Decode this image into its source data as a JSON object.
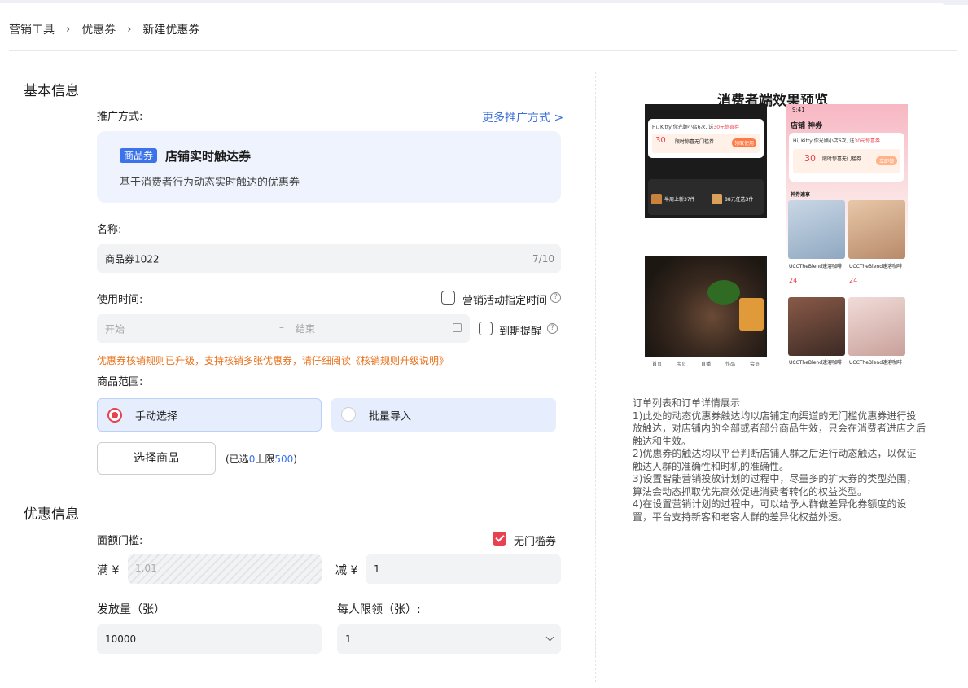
{
  "breadcrumb": [
    "营销工具",
    "优惠券",
    "新建优惠券"
  ],
  "sections": {
    "basic": "基本信息",
    "discount": "优惠信息"
  },
  "promo": {
    "label": "推广方式:",
    "more_link": "更多推广方式 >",
    "badge": "商品券",
    "title": "店铺实时触达券",
    "desc": "基于消费者行为动态实时触达的优惠券"
  },
  "name": {
    "label": "名称:",
    "value": "商品券1022",
    "counter": "7/10"
  },
  "time": {
    "label": "使用时间:",
    "campaign_check": "营销活动指定时间",
    "start_placeholder": "开始",
    "dash": "–",
    "end_placeholder": "结束",
    "remind_check": "到期提醒"
  },
  "warning": "优惠券核销规则已升级，支持核销多张优惠券，请仔细阅读《核销规则升级说明》",
  "scope": {
    "label": "商品范围:",
    "manual": "手动选择",
    "batch": "批量导入",
    "select_button": "选择商品",
    "selected_prefix": "(已选",
    "selected_count": "0",
    "limit_prefix": "上限",
    "limit_value": "500",
    "selected_suffix": ")"
  },
  "threshold": {
    "label": "面额门槛:",
    "no_threshold": "无门槛券",
    "full_label": "满 ¥",
    "full_value": "1.01",
    "minus_label": "减 ¥",
    "minus_value": "1"
  },
  "quantity": {
    "label": "发放量（张）",
    "value": "10000"
  },
  "per_user": {
    "label": "每人限领（张）:",
    "value": "1"
  },
  "preview": {
    "title": "消费者端效果预览",
    "phone1": {
      "greeting": "Hi, Kitty 你光顾小店6次, 送",
      "greeting_hl": "30元惊喜券",
      "amount": "30",
      "coupon_title": "限时惊喜无门槛券",
      "btn": "领取使用",
      "item1": "半周上新37件",
      "item2": "88元任选3件",
      "tabs": [
        "首页",
        "宝贝",
        "直播",
        "作品",
        "会员"
      ]
    },
    "phone2": {
      "time": "9:41",
      "store": "店铺 神券",
      "greeting": "Hi, Kitty 你光顾小店6次, 送",
      "greeting_hl": "30元惊喜券",
      "amount": "30",
      "coupon_title": "限时惊喜无门槛券",
      "btn": "立即领",
      "section": "神券速享",
      "product_name": "UCCTheBlend速溶咖啡",
      "price": "24"
    }
  },
  "notes": [
    "订单列表和订单详情展示",
    "1)此处的动态优惠券触达均以店铺定向渠道的无门槛优惠券进行投放触达，对店铺内的全部或者部分商品生效，只会在消费者进店之后触达和生效。",
    "2)优惠券的触达均以平台判断店铺人群之后进行动态触达，以保证触达人群的准确性和时机的准确性。",
    "3)设置智能营销投放计划的过程中，尽量多的扩大券的类型范围，算法会动态抓取优先高效促进消费者转化的权益类型。",
    "4)在设置营销计划的过程中，可以给予人群做差异化券额度的设置，平台支持新客和老客人群的差异化权益外透。"
  ],
  "colors": {
    "accent_blue": "#3c72ea",
    "accent_red": "#e8414f",
    "warning": "#e8701a",
    "link": "#3b6fd8"
  }
}
